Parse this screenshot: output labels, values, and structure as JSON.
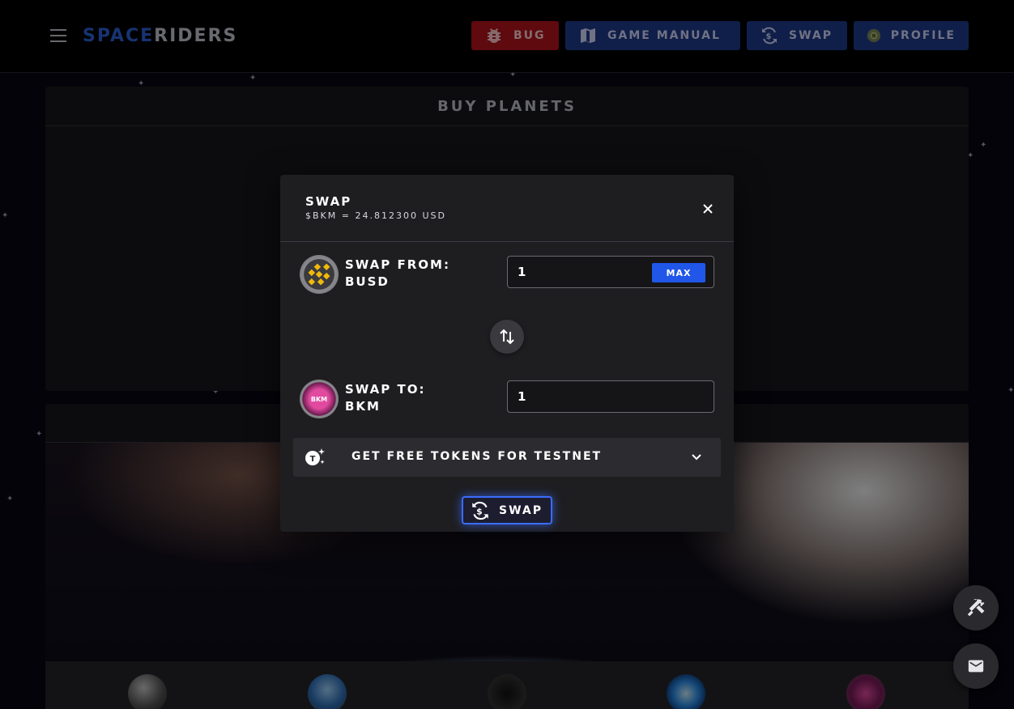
{
  "header": {
    "logo_part1": "SPACE",
    "logo_part2": "RIDERS",
    "buttons": {
      "bug": "BUG",
      "manual": "GAME MANUAL",
      "swap": "SWAP",
      "profile": "PROFILE"
    }
  },
  "buy_panel": {
    "title": "BUY PLANETS"
  },
  "modal": {
    "title": "SWAP",
    "rate": "$BKM = 24.812300 USD",
    "from": {
      "label_line1": "SWAP FROM:",
      "label_line2": "BUSD",
      "value": "1",
      "max_label": "MAX"
    },
    "to": {
      "label_line1": "SWAP TO:",
      "label_line2": "BKM",
      "value": "1"
    },
    "free_tokens_label": "GET FREE TOKENS FOR TESTNET",
    "submit_label": "SWAP",
    "bkm_badge": "BKM"
  },
  "colors": {
    "accent_blue": "#2157e8",
    "bug_red": "#b4141e",
    "nav_blue": "#1f3c8c",
    "busd_yellow": "#f0b90b",
    "bkm_pink": "#c0307a"
  }
}
